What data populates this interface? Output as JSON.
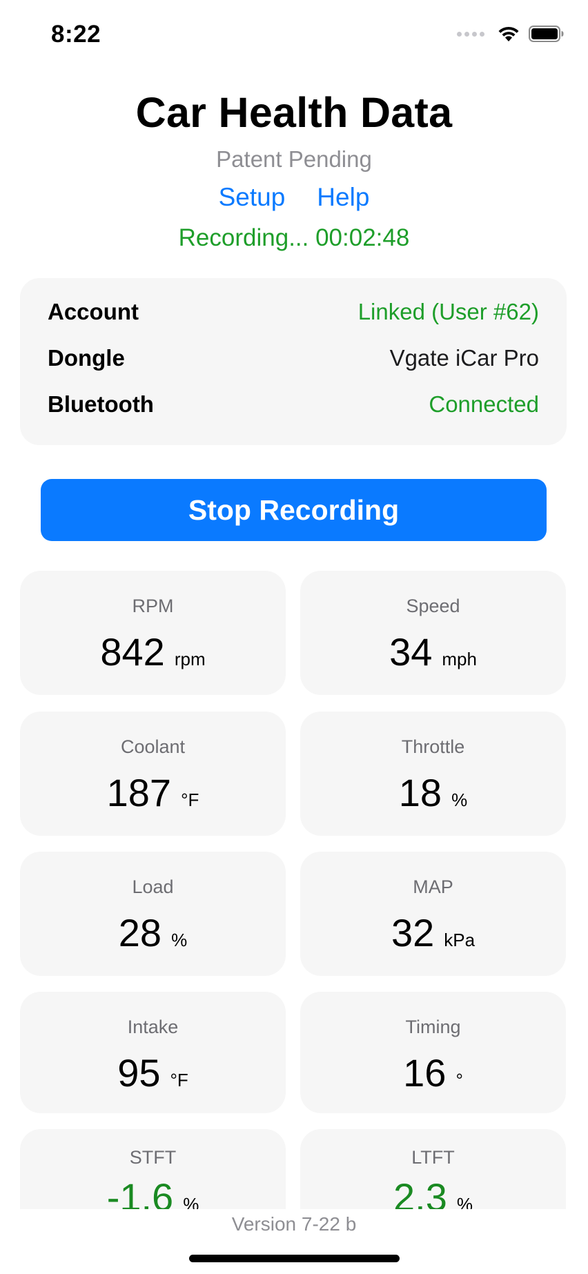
{
  "status_bar": {
    "time": "8:22",
    "icons": [
      "cellular-signal-icon",
      "wifi-icon",
      "battery-icon"
    ]
  },
  "header": {
    "title": "Car Health Data",
    "subtitle": "Patent Pending",
    "links": {
      "setup": "Setup",
      "help": "Help"
    },
    "recording_status": "Recording... 00:02:48"
  },
  "info": {
    "rows": [
      {
        "label": "Account",
        "value": "Linked (User #62)",
        "value_color": "#1e9e2a"
      },
      {
        "label": "Dongle",
        "value": "Vgate iCar Pro",
        "value_color": "#1c1c1e"
      },
      {
        "label": "Bluetooth",
        "value": "Connected",
        "value_color": "#1e9e2a"
      }
    ]
  },
  "actions": {
    "stop_recording": "Stop Recording"
  },
  "metrics": [
    {
      "label": "RPM",
      "value": "842",
      "unit": "rpm"
    },
    {
      "label": "Speed",
      "value": "34",
      "unit": "mph"
    },
    {
      "label": "Coolant",
      "value": "187",
      "unit": "°F"
    },
    {
      "label": "Throttle",
      "value": "18",
      "unit": "%"
    },
    {
      "label": "Load",
      "value": "28",
      "unit": "%"
    },
    {
      "label": "MAP",
      "value": "32",
      "unit": "kPa"
    },
    {
      "label": "Intake",
      "value": "95",
      "unit": "°F"
    },
    {
      "label": "Timing",
      "value": "16",
      "unit": "°"
    },
    {
      "label": "STFT",
      "value": "-1.6",
      "unit": "%"
    },
    {
      "label": "LTFT",
      "value": "2.3",
      "unit": "%"
    }
  ],
  "footer": {
    "version": "Version 7-22 b"
  },
  "colors": {
    "accent": "#0a7aff",
    "success": "#1e9e2a",
    "card_bg": "#f6f6f6",
    "muted_text": "#8e8e93"
  }
}
